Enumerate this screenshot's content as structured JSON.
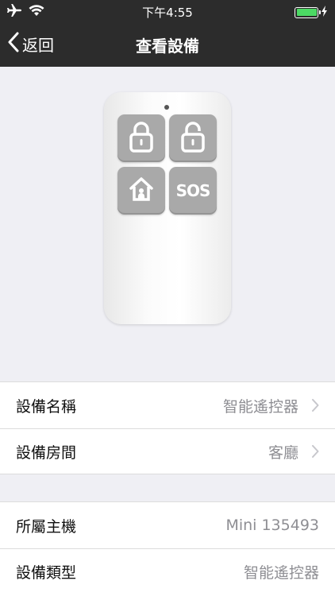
{
  "status_bar": {
    "time": "下午4:55",
    "icons": [
      "airplane-icon",
      "wifi-icon",
      "battery-icon",
      "charging-icon"
    ]
  },
  "nav": {
    "back_label": "返回",
    "title": "查看設備"
  },
  "device_image": {
    "buttons": [
      "lock-icon",
      "unlock-icon",
      "home-icon",
      "SOS"
    ]
  },
  "group1": {
    "rows": [
      {
        "label": "設備名稱",
        "value": "智能遙控器"
      },
      {
        "label": "設備房間",
        "value": "客廳"
      }
    ]
  },
  "group2": {
    "rows": [
      {
        "label": "所屬主機",
        "value": "Mini 135493"
      },
      {
        "label": "設備類型",
        "value": "智能遙控器"
      }
    ]
  },
  "colors": {
    "nav_background": "#2c2c2c",
    "page_background": "#efeff4",
    "battery": "#4cd964",
    "secondary_text": "#8e8e93"
  }
}
